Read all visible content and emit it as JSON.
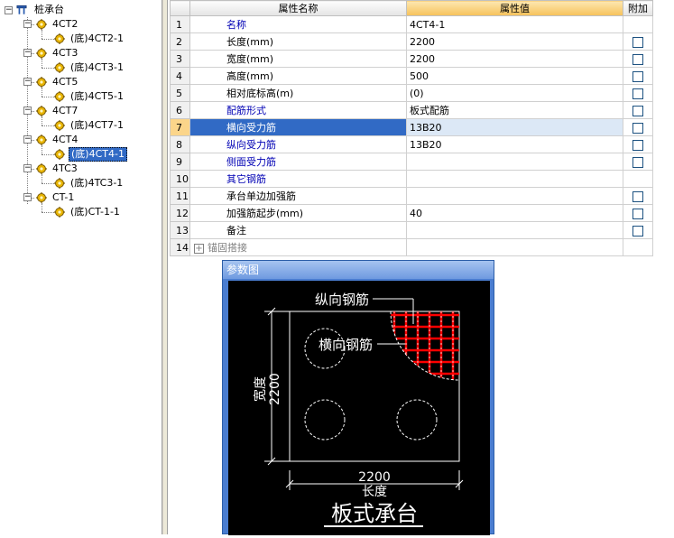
{
  "tree": {
    "root": "桩承台",
    "groups": [
      {
        "label": "4CT2",
        "child": "(底)4CT2-1"
      },
      {
        "label": "4CT3",
        "child": "(底)4CT3-1"
      },
      {
        "label": "4CT5",
        "child": "(底)4CT5-1"
      },
      {
        "label": "4CT7",
        "child": "(底)4CT7-1"
      },
      {
        "label": "4CT4",
        "child": "(底)4CT4-1"
      },
      {
        "label": "4TC3",
        "child": "(底)4TC3-1"
      },
      {
        "label": "CT-1",
        "child": "(底)CT-1-1"
      }
    ]
  },
  "grid": {
    "headers": {
      "name": "属性名称",
      "value": "属性值",
      "extra": "附加"
    },
    "rows": [
      {
        "num": "1",
        "name": "名称",
        "value": "4CT4-1"
      },
      {
        "num": "2",
        "name": "长度(mm)",
        "value": "2200"
      },
      {
        "num": "3",
        "name": "宽度(mm)",
        "value": "2200"
      },
      {
        "num": "4",
        "name": "高度(mm)",
        "value": "500"
      },
      {
        "num": "5",
        "name": "相对底标高(m)",
        "value": "(0)"
      },
      {
        "num": "6",
        "name": "配筋形式",
        "value": "板式配筋"
      },
      {
        "num": "7",
        "name": "横向受力筋",
        "value": "13B20"
      },
      {
        "num": "8",
        "name": "纵向受力筋",
        "value": "13B20"
      },
      {
        "num": "9",
        "name": "侧面受力筋",
        "value": ""
      },
      {
        "num": "10",
        "name": "其它钢筋",
        "value": ""
      },
      {
        "num": "11",
        "name": "承台单边加强筋",
        "value": ""
      },
      {
        "num": "12",
        "name": "加强筋起步(mm)",
        "value": "40"
      },
      {
        "num": "13",
        "name": "备注",
        "value": ""
      },
      {
        "num": "14",
        "name": "锚固搭接",
        "value": ""
      }
    ]
  },
  "diagram": {
    "title": "参数图",
    "label_longitudinal": "纵向钢筋",
    "label_transverse": "横向钢筋",
    "width_label": "宽度",
    "width_value": "2200",
    "length_value": "2200",
    "length_label": "长度",
    "caption": "板式承台"
  },
  "colors": {
    "selection": "#316ac5",
    "rebar": "#ff0000",
    "blue_text": "#0000b4"
  }
}
